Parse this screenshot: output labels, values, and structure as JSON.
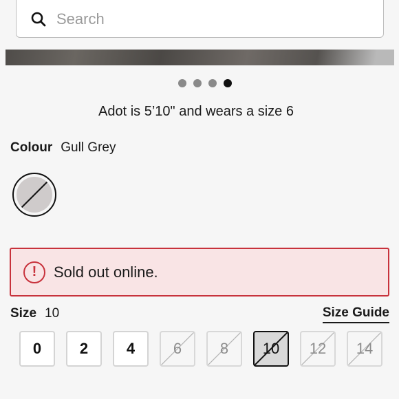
{
  "search": {
    "placeholder": "Search"
  },
  "carousel": {
    "dot_count": 4,
    "active_index": 3
  },
  "model_caption": "Adot is 5’10\" and wears a size 6",
  "colour": {
    "label": "Colour",
    "value": "Gull Grey",
    "swatch_color": "#cfcbcb"
  },
  "alert": {
    "icon": "exclamation-circle-icon",
    "text": "Sold out online.",
    "color": "#c8323c",
    "background": "#f9e4e5"
  },
  "size": {
    "label": "Size",
    "selected": "10",
    "guide_label": "Size Guide",
    "options": [
      {
        "label": "0",
        "available": true,
        "selected": false
      },
      {
        "label": "2",
        "available": true,
        "selected": false
      },
      {
        "label": "4",
        "available": true,
        "selected": false
      },
      {
        "label": "6",
        "available": false,
        "selected": false
      },
      {
        "label": "8",
        "available": false,
        "selected": false
      },
      {
        "label": "10",
        "available": false,
        "selected": true
      },
      {
        "label": "12",
        "available": false,
        "selected": false
      },
      {
        "label": "14",
        "available": false,
        "selected": false
      }
    ]
  }
}
